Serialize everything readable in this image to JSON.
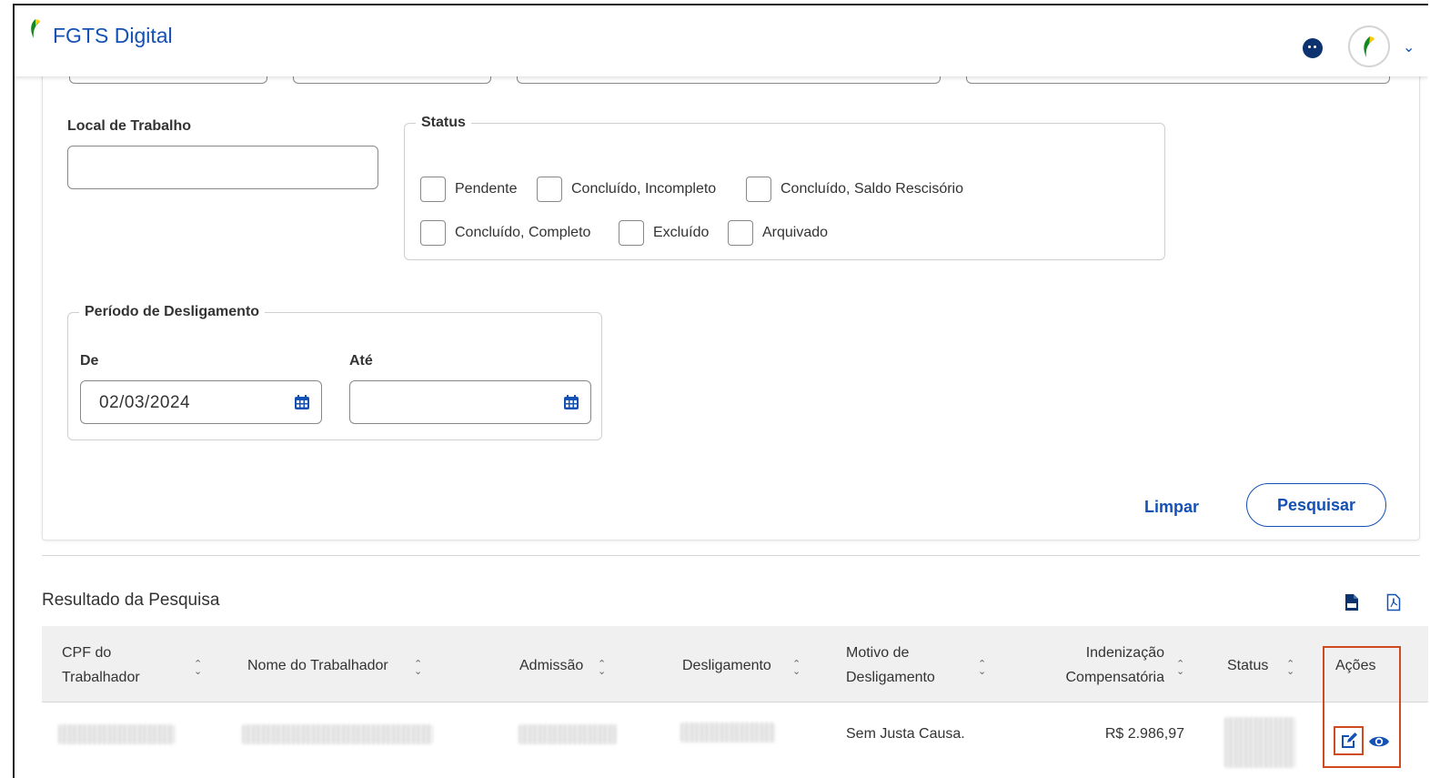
{
  "app": {
    "title": "FGTS Digital"
  },
  "filters": {
    "local_trabalho_label": "Local de Trabalho",
    "status": {
      "legend": "Status",
      "options": [
        "Pendente",
        "Concluído, Incompleto",
        "Concluído, Saldo Rescisório",
        "Concluído, Completo",
        "Excluído",
        "Arquivado"
      ]
    },
    "periodo": {
      "legend": "Período de Desligamento",
      "from_label": "De",
      "from_value": "02/03/2024",
      "to_label": "Até",
      "to_value": ""
    },
    "clear_label": "Limpar",
    "search_label": "Pesquisar"
  },
  "results": {
    "title": "Resultado da Pesquisa",
    "columns": [
      {
        "line1": "CPF do",
        "line2": "Trabalhador"
      },
      {
        "line1": "Nome do Trabalhador",
        "line2": ""
      },
      {
        "line1": "Admissão",
        "line2": ""
      },
      {
        "line1": "Desligamento",
        "line2": ""
      },
      {
        "line1": "Motivo de",
        "line2": "Desligamento"
      },
      {
        "line1": "Indenização",
        "line2": "Compensatória"
      },
      {
        "line1": "Status",
        "line2": ""
      },
      {
        "line1": "Ações",
        "line2": ""
      }
    ],
    "row": {
      "motivo": "Sem Justa Causa.",
      "indenizacao": "R$ 2.986,97"
    }
  },
  "icons": {
    "accessibility": "accessibility-icon",
    "avatar": "gov-logo-avatar",
    "calendar": "calendar-icon",
    "csv": "csv-file-icon",
    "pdf": "pdf-file-icon",
    "edit": "edit-icon",
    "view": "eye-icon"
  },
  "colors": {
    "primary": "#1351b4",
    "highlight": "#d04a1f",
    "leaf_green": "#168821",
    "leaf_yellow": "#ffcd07"
  }
}
